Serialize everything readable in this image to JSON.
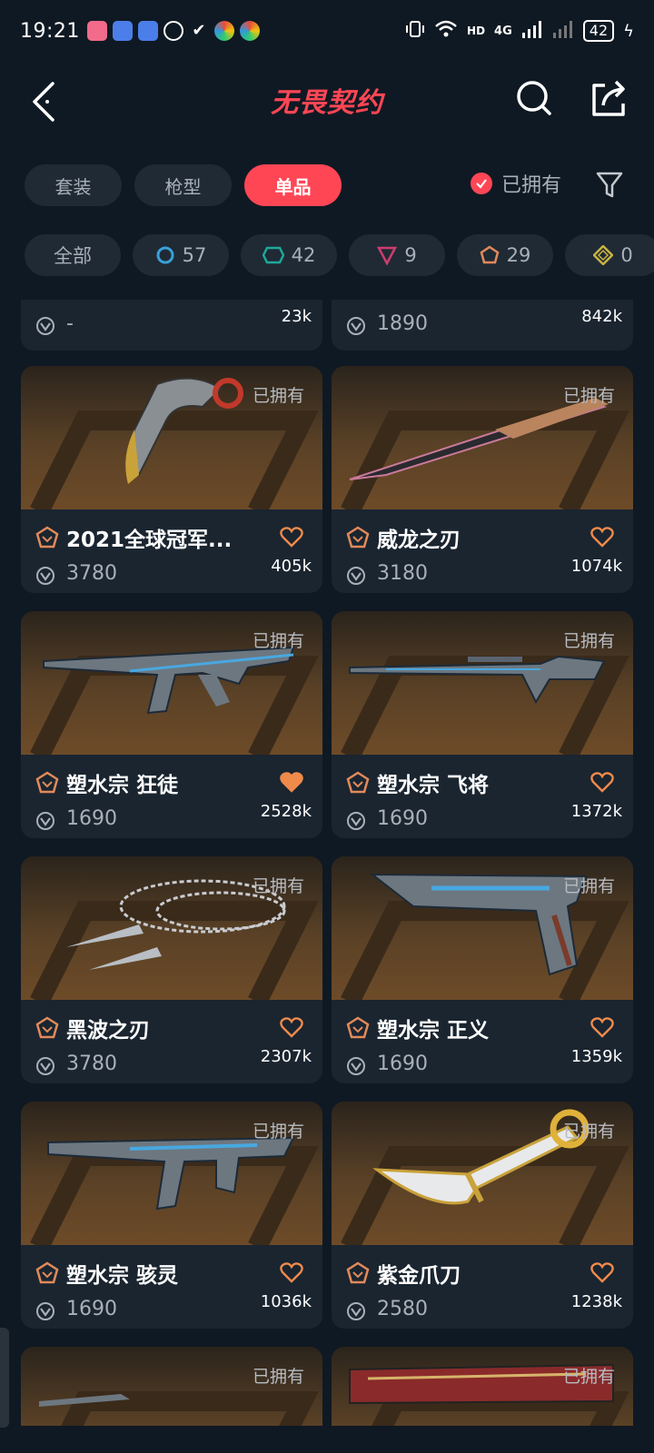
{
  "status_bar": {
    "time": "19:21",
    "network": "4G",
    "hd": "HD",
    "battery": "42"
  },
  "header": {
    "title": "无畏契约"
  },
  "tabs": [
    {
      "label": "套装"
    },
    {
      "label": "枪型"
    },
    {
      "label": "单品"
    }
  ],
  "owned_filter": {
    "label": "已拥有"
  },
  "rarity_chips": [
    {
      "label": "全部"
    },
    {
      "count": "57",
      "color": "#3aa0d8"
    },
    {
      "count": "42",
      "color": "#1fa89a"
    },
    {
      "count": "9",
      "color": "#d03c6e"
    },
    {
      "count": "29",
      "color": "#e28a5a"
    },
    {
      "count": "0",
      "color": "#c8b340"
    }
  ],
  "top_partial": [
    {
      "price": "-",
      "likes": "23k"
    },
    {
      "price": "1890",
      "likes": "842k"
    }
  ],
  "cards": [
    {
      "owned": "已拥有",
      "name": "2021全球冠军...",
      "price": "3780",
      "likes": "405k",
      "liked": false
    },
    {
      "owned": "已拥有",
      "name": "威龙之刃",
      "price": "3180",
      "likes": "1074k",
      "liked": false
    },
    {
      "owned": "已拥有",
      "name": "塑水宗 狂徒",
      "price": "1690",
      "likes": "2528k",
      "liked": true
    },
    {
      "owned": "已拥有",
      "name": "塑水宗 飞将",
      "price": "1690",
      "likes": "1372k",
      "liked": false
    },
    {
      "owned": "已拥有",
      "name": "黑波之刃",
      "price": "3780",
      "likes": "2307k",
      "liked": false
    },
    {
      "owned": "已拥有",
      "name": "塑水宗 正义",
      "price": "1690",
      "likes": "1359k",
      "liked": false
    },
    {
      "owned": "已拥有",
      "name": "塑水宗 骇灵",
      "price": "1690",
      "likes": "1036k",
      "liked": false
    },
    {
      "owned": "已拥有",
      "name": "紫金爪刀",
      "price": "2580",
      "likes": "1238k",
      "liked": false
    },
    {
      "owned": "已拥有"
    },
    {
      "owned": "已拥有"
    }
  ],
  "colors": {
    "accent": "#ff4655",
    "background": "#0f1923",
    "card": "#1a2530",
    "rarity_exclusive": "#e28a5a",
    "heart": "#f08a4b"
  }
}
